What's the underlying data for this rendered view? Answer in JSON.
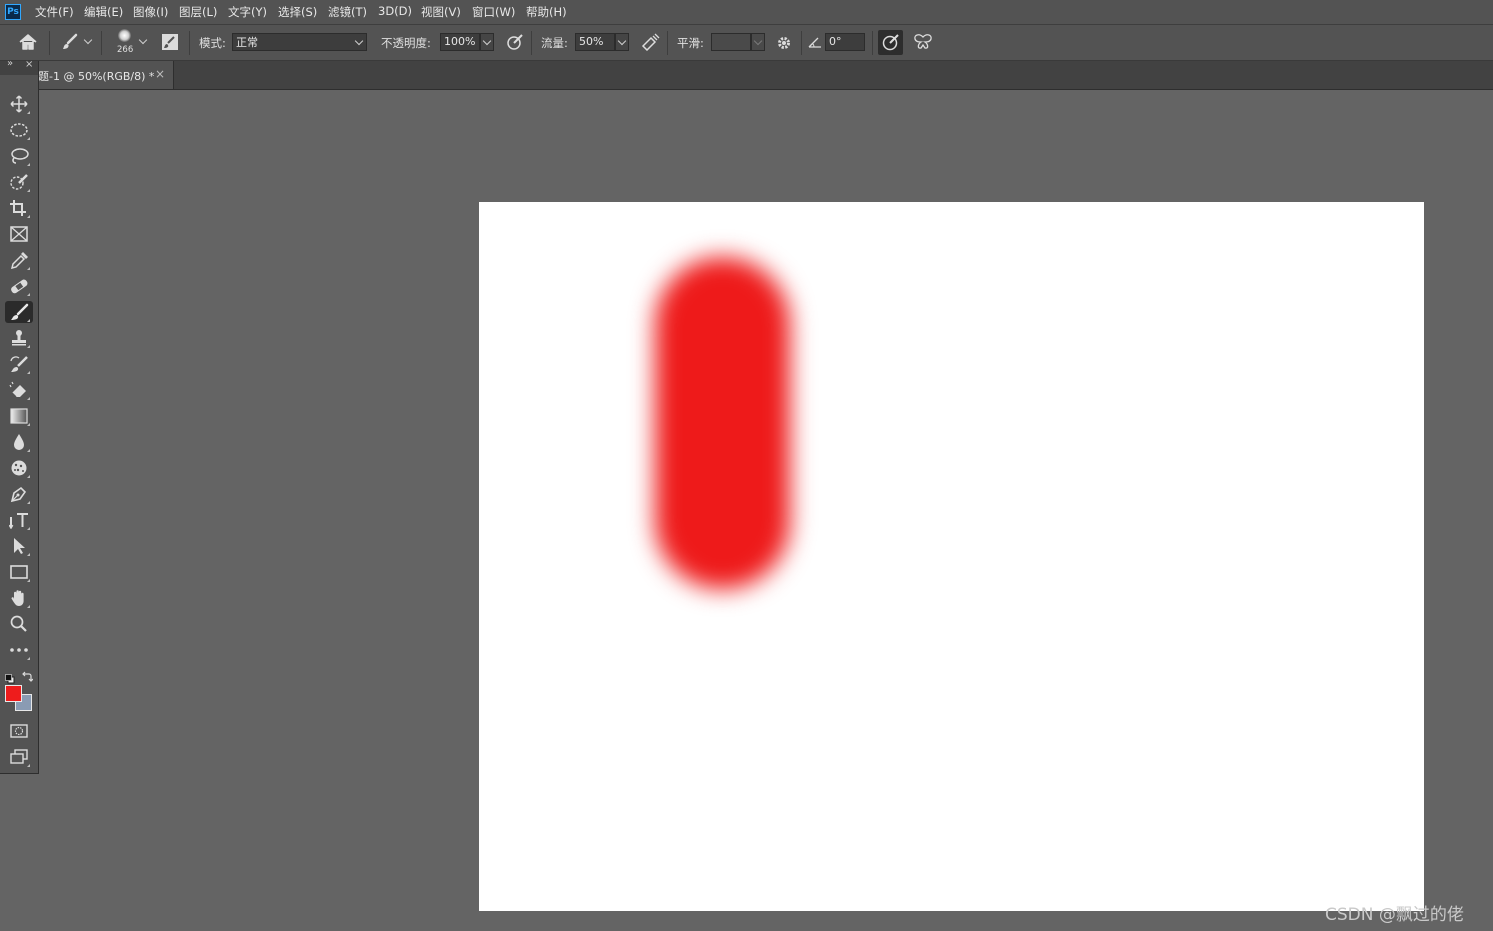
{
  "app": {
    "logo_text": "Ps"
  },
  "menu": {
    "items": [
      {
        "label": "文件(F)"
      },
      {
        "label": "编辑(E)"
      },
      {
        "label": "图像(I)"
      },
      {
        "label": "图层(L)"
      },
      {
        "label": "文字(Y)"
      },
      {
        "label": "选择(S)"
      },
      {
        "label": "滤镜(T)"
      },
      {
        "label": "3D(D)"
      },
      {
        "label": "视图(V)"
      },
      {
        "label": "窗口(W)"
      },
      {
        "label": "帮助(H)"
      }
    ]
  },
  "options": {
    "brush_size": "266",
    "mode_label": "模式:",
    "mode_value": "正常",
    "opacity_label": "不透明度:",
    "opacity_value": "100%",
    "flow_label": "流量:",
    "flow_value": "50%",
    "smoothing_label": "平滑:",
    "smoothing_value": "",
    "angle_value": "0°"
  },
  "document": {
    "tab_title": "题-1 @ 50%(RGB/8) *",
    "tab_close": "×",
    "zoom": "50%",
    "color_mode": "RGB/8"
  },
  "tools": {
    "active": "brush-tool",
    "items": [
      {
        "name": "move-tool"
      },
      {
        "name": "elliptical-marquee-tool"
      },
      {
        "name": "lasso-tool"
      },
      {
        "name": "quick-selection-tool"
      },
      {
        "name": "crop-tool"
      },
      {
        "name": "frame-tool"
      },
      {
        "name": "eyedropper-tool"
      },
      {
        "name": "healing-brush-tool"
      },
      {
        "name": "brush-tool"
      },
      {
        "name": "clone-stamp-tool"
      },
      {
        "name": "history-brush-tool"
      },
      {
        "name": "eraser-tool"
      },
      {
        "name": "gradient-tool"
      },
      {
        "name": "blur-tool"
      },
      {
        "name": "sponge-tool"
      },
      {
        "name": "pen-tool"
      },
      {
        "name": "type-tool"
      },
      {
        "name": "path-selection-tool"
      },
      {
        "name": "rectangle-tool"
      },
      {
        "name": "hand-tool"
      },
      {
        "name": "zoom-tool"
      },
      {
        "name": "more-tools"
      }
    ]
  },
  "colors": {
    "foreground": "#ee1c1c",
    "background": "#8a9bb3",
    "stroke": "#ee1a1a"
  },
  "watermark": "CSDN @飘过的佬"
}
